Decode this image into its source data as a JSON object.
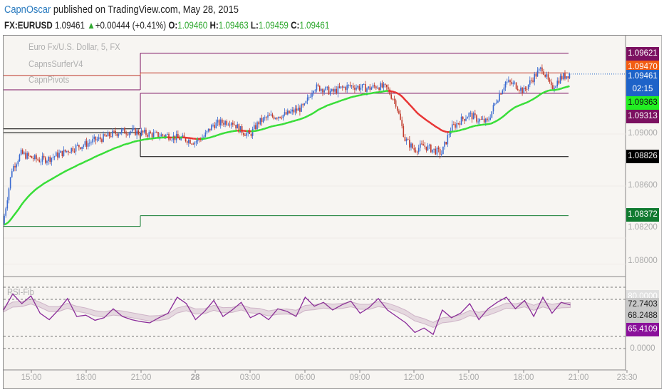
{
  "header": {
    "author": "CapnOscar",
    "published": "published on TradingView.com, May 28, 2015",
    "symbol": "FX:EURUSD",
    "last": "1.09461",
    "arrow": "▲",
    "change": "+0.00444 (+0.41%)",
    "o_label": "O:",
    "o": "1.09460",
    "h_label": "H:",
    "h": "1.09463",
    "l_label": "L:",
    "l": "1.09459",
    "c_label": "C:",
    "c": "1.09461"
  },
  "legend": {
    "series": "Euro Fx/U.S. Dollar, 5, FX",
    "ind1": "CapnsSurferV4",
    "ind2": "CapnPivots",
    "rsi": "RSI-Fib"
  },
  "price_labels": [
    {
      "text": "1.09621",
      "color": "#7b1060"
    },
    {
      "text": "1.09470",
      "color": "#f25c12"
    },
    {
      "text": "1.09461",
      "color": "#1e63c8"
    },
    {
      "text": "02:15",
      "color": "#1e63c8"
    },
    {
      "text": "1.09363",
      "color": "#22ee22",
      "fg": "#111"
    },
    {
      "text": "1.09313",
      "color": "#7b1060"
    },
    {
      "text": "1.08826",
      "color": "#000000"
    },
    {
      "text": "1.08372",
      "color": "#107a30"
    }
  ],
  "price_ticks": [
    "1.09000",
    "1.08600",
    "1.08200",
    "1.08000"
  ],
  "rsi_labels": [
    {
      "text": "80.0000",
      "color": "#e0e0e0"
    },
    {
      "text": "72.7403",
      "color": "#c8c8c8",
      "fg": "#222"
    },
    {
      "text": "68.2488",
      "color": "#c8c8c8",
      "fg": "#222"
    },
    {
      "text": "65.4109",
      "color": "#8a109a"
    }
  ],
  "rsi_zero": "0.0000",
  "time_ticks": [
    "15:00",
    "18:00",
    "21:00",
    "28",
    "03:00",
    "06:00",
    "09:00",
    "12:00",
    "15:00",
    "18:00",
    "21:00",
    "23:30"
  ],
  "chart_data": {
    "type": "candlestick",
    "interval": "5m sampled every 30m",
    "closes": [
      1.083,
      1.0873,
      1.0885,
      1.0882,
      1.088,
      1.0881,
      1.0884,
      1.0887,
      1.089,
      1.0892,
      1.0895,
      1.0897,
      1.09,
      1.0902,
      1.0902,
      1.0901,
      1.09,
      1.0899,
      1.0899,
      1.0897,
      1.0896,
      1.0894,
      1.0898,
      1.0907,
      1.0909,
      1.091,
      1.0903,
      1.0899,
      1.0909,
      1.0913,
      1.0914,
      1.0915,
      1.0918,
      1.0921,
      1.0936,
      1.0935,
      1.0932,
      1.0935,
      1.0937,
      1.0936,
      1.0935,
      1.0937,
      1.0935,
      1.0924,
      1.0896,
      1.0888,
      1.0891,
      1.0888,
      1.0885,
      1.0904,
      1.091,
      1.0915,
      1.0911,
      1.0909,
      1.0926,
      1.094,
      1.0938,
      1.0933,
      1.0943,
      1.0951,
      1.0935,
      1.0943,
      1.09461
    ],
    "pivots_day1": [
      1.0934,
      1.0945,
      1.0904,
      1.0901,
      1.0829
    ],
    "pivots_day2": [
      1.09621,
      1.0947,
      1.09313,
      1.08826,
      1.08372
    ],
    "rsi": [
      60,
      85,
      70,
      82,
      55,
      45,
      60,
      78,
      50,
      52,
      44,
      48,
      62,
      50,
      45,
      42,
      40,
      48,
      55,
      80,
      70,
      45,
      58,
      75,
      50,
      60,
      72,
      48,
      55,
      45,
      62,
      58,
      50,
      80,
      66,
      72,
      60,
      68,
      74,
      55,
      64,
      78,
      60,
      50,
      40,
      25,
      32,
      22,
      60,
      48,
      55,
      70,
      45,
      62,
      72,
      80,
      62,
      75,
      50,
      80,
      55,
      72,
      68
    ],
    "ylim": [
      1.079,
      1.0968
    ]
  }
}
